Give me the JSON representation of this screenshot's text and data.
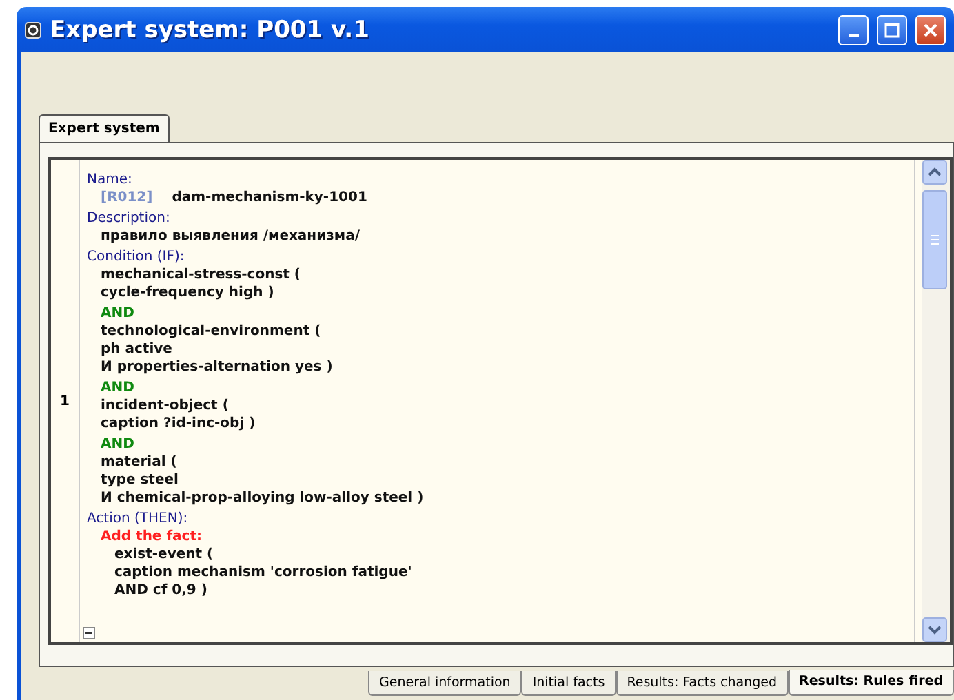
{
  "window": {
    "title": "Expert system: P001 v.1"
  },
  "top_tabs": [
    {
      "label": "Expert system",
      "selected": true
    }
  ],
  "rule": {
    "row_number": "1",
    "lines": [
      {
        "kind": "label",
        "text": "Name:"
      },
      {
        "kind": "name",
        "id": "[R012]",
        "text": "dam-mechanism-ky-1001"
      },
      {
        "kind": "label",
        "text": "Description:"
      },
      {
        "kind": "text",
        "text": "правило выявления /механизма/"
      },
      {
        "kind": "label",
        "text": "Condition (IF):"
      },
      {
        "kind": "text",
        "text": "mechanical-stress-const ("
      },
      {
        "kind": "text",
        "text": "cycle-frequency  high )"
      },
      {
        "kind": "keyword",
        "text": "AND"
      },
      {
        "kind": "text",
        "text": "technological-environment ("
      },
      {
        "kind": "text",
        "text": "ph  active"
      },
      {
        "kind": "text",
        "text": "И properties-alternation  yes )"
      },
      {
        "kind": "keyword",
        "text": "AND"
      },
      {
        "kind": "text",
        "text": "incident-object ("
      },
      {
        "kind": "text",
        "text": "caption  ?id-inc-obj )"
      },
      {
        "kind": "keyword",
        "text": "AND"
      },
      {
        "kind": "text",
        "text": "material ("
      },
      {
        "kind": "text",
        "text": "type  steel"
      },
      {
        "kind": "text",
        "text": "И chemical-prop-alloying  low-alloy steel )"
      },
      {
        "kind": "label",
        "text": "Action (THEN):"
      },
      {
        "kind": "action",
        "text": "Add the fact:"
      },
      {
        "kind": "fact",
        "text": "exist-event ("
      },
      {
        "kind": "fact",
        "text": "caption  mechanism 'corrosion fatigue'"
      },
      {
        "kind": "fact",
        "text": "AND cf  0,9 )"
      }
    ]
  },
  "bottom_tabs": [
    {
      "label": "General information",
      "selected": false
    },
    {
      "label": "Initial facts",
      "selected": false
    },
    {
      "label": "Results: Facts changed",
      "selected": false
    },
    {
      "label": "Results: Rules fired",
      "selected": true
    }
  ]
}
